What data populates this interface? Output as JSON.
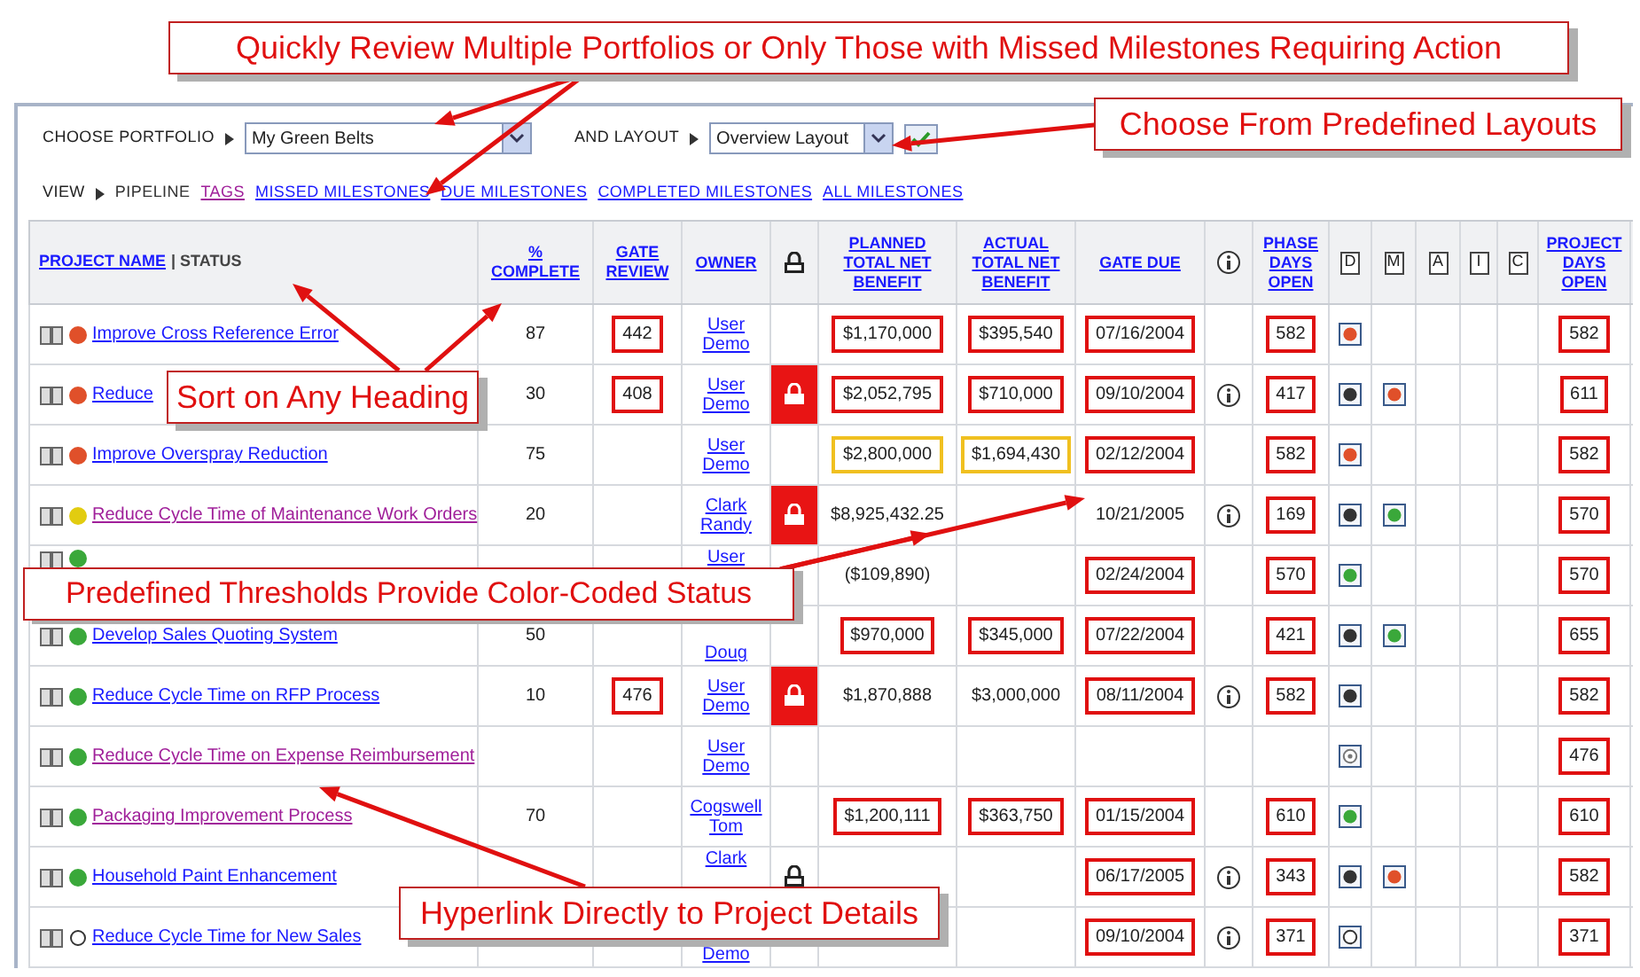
{
  "callouts": [
    {
      "text": "Quickly Review Multiple Portfolios or Only Those with Missed Milestones Requiring Action"
    },
    {
      "text": "Choose From Predefined Layouts"
    },
    {
      "text": "Sort on Any Heading"
    },
    {
      "text": "Predefined Thresholds Provide Color-Coded Status"
    },
    {
      "text": "Hyperlink Directly to Project Details"
    }
  ],
  "toolbar": {
    "portfolio_label": "CHOOSE PORTFOLIO",
    "portfolio_value": "My Green Belts",
    "layout_label": "AND LAYOUT",
    "layout_value": "Overview Layout"
  },
  "view": {
    "label": "VIEW",
    "items": [
      {
        "label": "PIPELINE",
        "selected": true,
        "visited": false
      },
      {
        "label": "TAGS",
        "selected": false,
        "visited": true
      },
      {
        "label": "MISSED MILESTONES",
        "selected": false,
        "visited": false
      },
      {
        "label": "DUE MILESTONES",
        "selected": false,
        "visited": false
      },
      {
        "label": "COMPLETED MILESTONES",
        "selected": false,
        "visited": false
      },
      {
        "label": "ALL MILESTONES",
        "selected": false,
        "visited": false
      }
    ]
  },
  "columns": [
    {
      "kind": "name",
      "label": "PROJECT NAME",
      "sublabel": "| STATUS"
    },
    {
      "kind": "text",
      "label": "% COMPLETE"
    },
    {
      "kind": "text",
      "label": "GATE REVIEW"
    },
    {
      "kind": "text",
      "label": "OWNER"
    },
    {
      "kind": "lock"
    },
    {
      "kind": "text",
      "label": "PLANNED TOTAL NET BENEFIT"
    },
    {
      "kind": "text",
      "label": "ACTUAL TOTAL NET BENEFIT"
    },
    {
      "kind": "text",
      "label": "GATE DUE"
    },
    {
      "kind": "info"
    },
    {
      "kind": "text",
      "label": "PHASE DAYS OPEN"
    },
    {
      "kind": "box",
      "label": "D"
    },
    {
      "kind": "box",
      "label": "M"
    },
    {
      "kind": "box",
      "label": "A"
    },
    {
      "kind": "box",
      "label": "I"
    },
    {
      "kind": "box",
      "label": "C"
    },
    {
      "kind": "text",
      "label": "PROJECT DAYS OPEN"
    }
  ],
  "rows": [
    {
      "status": {
        "color": "#e0502a"
      },
      "name": "Improve Cross Reference Error",
      "visited": false,
      "pct": "87",
      "gate": {
        "value": "442",
        "color": "#e01010"
      },
      "owner": {
        "lines": [
          "User",
          "Demo"
        ]
      },
      "planned": {
        "value": "$1,170,000",
        "color": "#e01010"
      },
      "actual": {
        "value": "$395,540",
        "color": "#e01010"
      },
      "due": {
        "value": "07/16/2004",
        "color": "#e01010"
      },
      "info": false,
      "phase": {
        "value": "582",
        "color": "#e01010"
      },
      "d": {
        "kind": "dot",
        "color": "#e0502a"
      },
      "days": {
        "value": "582",
        "color": "#e01010"
      }
    },
    {
      "status": {
        "color": "#e0502a"
      },
      "name": "Reduce",
      "visited": false,
      "pct": "30",
      "gate": {
        "value": "408",
        "color": "#e01010"
      },
      "owner": {
        "lines": [
          "User",
          "Demo"
        ]
      },
      "lock": {
        "highlight": true
      },
      "planned": {
        "value": "$2,052,795",
        "color": "#e01010"
      },
      "actual": {
        "value": "$710,000",
        "color": "#e01010"
      },
      "due": {
        "value": "09/10/2004",
        "color": "#e01010"
      },
      "info": true,
      "phase": {
        "value": "417",
        "color": "#e01010"
      },
      "d": {
        "kind": "dot",
        "color": "#333333"
      },
      "m": {
        "kind": "dot",
        "color": "#e0502a"
      },
      "days": {
        "value": "611",
        "color": "#e01010"
      }
    },
    {
      "status": {
        "color": "#e0502a"
      },
      "name": "Improve Overspray Reduction",
      "visited": false,
      "pct": "75",
      "owner": {
        "lines": [
          "User",
          "Demo"
        ]
      },
      "planned": {
        "value": "$2,800,000",
        "color": "#f0c020"
      },
      "actual": {
        "value": "$1,694,430",
        "color": "#f0c020"
      },
      "due": {
        "value": "02/12/2004",
        "color": "#e01010"
      },
      "info": false,
      "phase": {
        "value": "582",
        "color": "#e01010"
      },
      "d": {
        "kind": "dot",
        "color": "#e0502a"
      },
      "days": {
        "value": "582",
        "color": "#e01010"
      }
    },
    {
      "status": {
        "color": "#e2cc10"
      },
      "name": "Reduce Cycle Time of Maintenance Work Orders",
      "visited": true,
      "pct": "20",
      "owner": {
        "lines": [
          "Clark",
          "Randy"
        ]
      },
      "lock": {
        "highlight": true
      },
      "planned": {
        "value": "$8,925,432.25"
      },
      "due": {
        "value": "10/21/2005"
      },
      "info": true,
      "phase": {
        "value": "169",
        "color": "#e01010"
      },
      "d": {
        "kind": "dot",
        "color": "#333333"
      },
      "m": {
        "kind": "dot",
        "color": "#3aa83a"
      },
      "days": {
        "value": "570",
        "color": "#e01010"
      }
    },
    {
      "status": {
        "color": "#3aa83a"
      },
      "owner": {
        "lines": [
          "User"
        ],
        "cut_below": true
      },
      "planned": {
        "value": "($109,890)"
      },
      "due": {
        "value": "02/24/2004",
        "color": "#e01010"
      },
      "info": false,
      "phase": {
        "value": "570",
        "color": "#e01010"
      },
      "d": {
        "kind": "dot",
        "color": "#3aa83a"
      },
      "days": {
        "value": "570",
        "color": "#e01010"
      }
    },
    {
      "status": {
        "color": "#3aa83a"
      },
      "name": "Develop Sales Quoting System",
      "visited": false,
      "pct": "50",
      "owner": {
        "lines": [
          "Doug"
        ],
        "cut_below": false
      },
      "planned": {
        "value": "$970,000",
        "color": "#e01010"
      },
      "actual": {
        "value": "$345,000",
        "color": "#e01010"
      },
      "due": {
        "value": "07/22/2004",
        "color": "#e01010"
      },
      "info": false,
      "phase": {
        "value": "421",
        "color": "#e01010"
      },
      "d": {
        "kind": "dot",
        "color": "#333333"
      },
      "m": {
        "kind": "dot",
        "color": "#3aa83a"
      },
      "days": {
        "value": "655",
        "color": "#e01010"
      }
    },
    {
      "status": {
        "color": "#3aa83a"
      },
      "name": "Reduce Cycle Time on RFP Process",
      "visited": false,
      "pct": "10",
      "gate": {
        "value": "476",
        "color": "#e01010"
      },
      "owner": {
        "lines": [
          "User",
          "Demo"
        ]
      },
      "lock": {
        "highlight": true
      },
      "planned": {
        "value": "$1,870,888"
      },
      "actual": {
        "value": "$3,000,000"
      },
      "due": {
        "value": "08/11/2004",
        "color": "#e01010"
      },
      "info": true,
      "phase": {
        "value": "582",
        "color": "#e01010"
      },
      "d": {
        "kind": "dot",
        "color": "#333333"
      },
      "days": {
        "value": "582",
        "color": "#e01010"
      }
    },
    {
      "status": {
        "color": "#3aa83a"
      },
      "name": "Reduce Cycle Time on Expense Reimbursement",
      "visited": true,
      "owner": {
        "lines": [
          "User",
          "Demo"
        ]
      },
      "info": false,
      "d": {
        "kind": "target"
      },
      "days": {
        "value": "476",
        "color": "#e01010"
      }
    },
    {
      "status": {
        "color": "#3aa83a"
      },
      "name": "Packaging Improvement Process",
      "visited": true,
      "pct": "70",
      "owner": {
        "lines": [
          "Cogswell",
          "Tom"
        ]
      },
      "planned": {
        "value": "$1,200,111",
        "color": "#e01010"
      },
      "actual": {
        "value": "$363,750",
        "color": "#e01010"
      },
      "due": {
        "value": "01/15/2004",
        "color": "#e01010"
      },
      "info": false,
      "phase": {
        "value": "610",
        "color": "#e01010"
      },
      "d": {
        "kind": "dot",
        "color": "#3aa83a"
      },
      "days": {
        "value": "610",
        "color": "#e01010"
      }
    },
    {
      "status": {
        "color": "#3aa83a"
      },
      "name": "Household Paint Enhancement",
      "visited": false,
      "owner": {
        "lines": [
          "Clark"
        ],
        "cut_below": true
      },
      "lock": {
        "highlight": false
      },
      "due": {
        "value": "06/17/2005",
        "color": "#e01010"
      },
      "info": true,
      "phase": {
        "value": "343",
        "color": "#e01010"
      },
      "d": {
        "kind": "dot",
        "color": "#333333"
      },
      "m": {
        "kind": "dot",
        "color": "#e0502a"
      },
      "days": {
        "value": "582",
        "color": "#e01010"
      }
    },
    {
      "status": {
        "kind": "ring"
      },
      "name": "Reduce Cycle Time for New Sales",
      "visited": false,
      "owner": {
        "lines": [
          "Demo"
        ],
        "cut_below": false
      },
      "due": {
        "value": "09/10/2004",
        "color": "#e01010"
      },
      "info": true,
      "phase": {
        "value": "371",
        "color": "#e01010"
      },
      "d": {
        "kind": "ring"
      },
      "days": {
        "value": "371",
        "color": "#e01010"
      }
    }
  ]
}
